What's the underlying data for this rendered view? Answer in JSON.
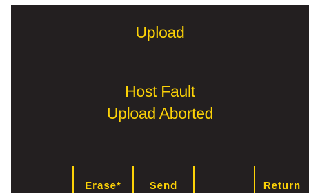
{
  "screen": {
    "title": "Upload",
    "message_line1": "Host Fault",
    "message_line2": "Upload Aborted"
  },
  "softkeys": {
    "key1": "",
    "key2": "Erase*",
    "key3": "Send",
    "key4": "",
    "key5": "Return"
  },
  "colors": {
    "background": "#231f20",
    "text": "#fcd207"
  }
}
